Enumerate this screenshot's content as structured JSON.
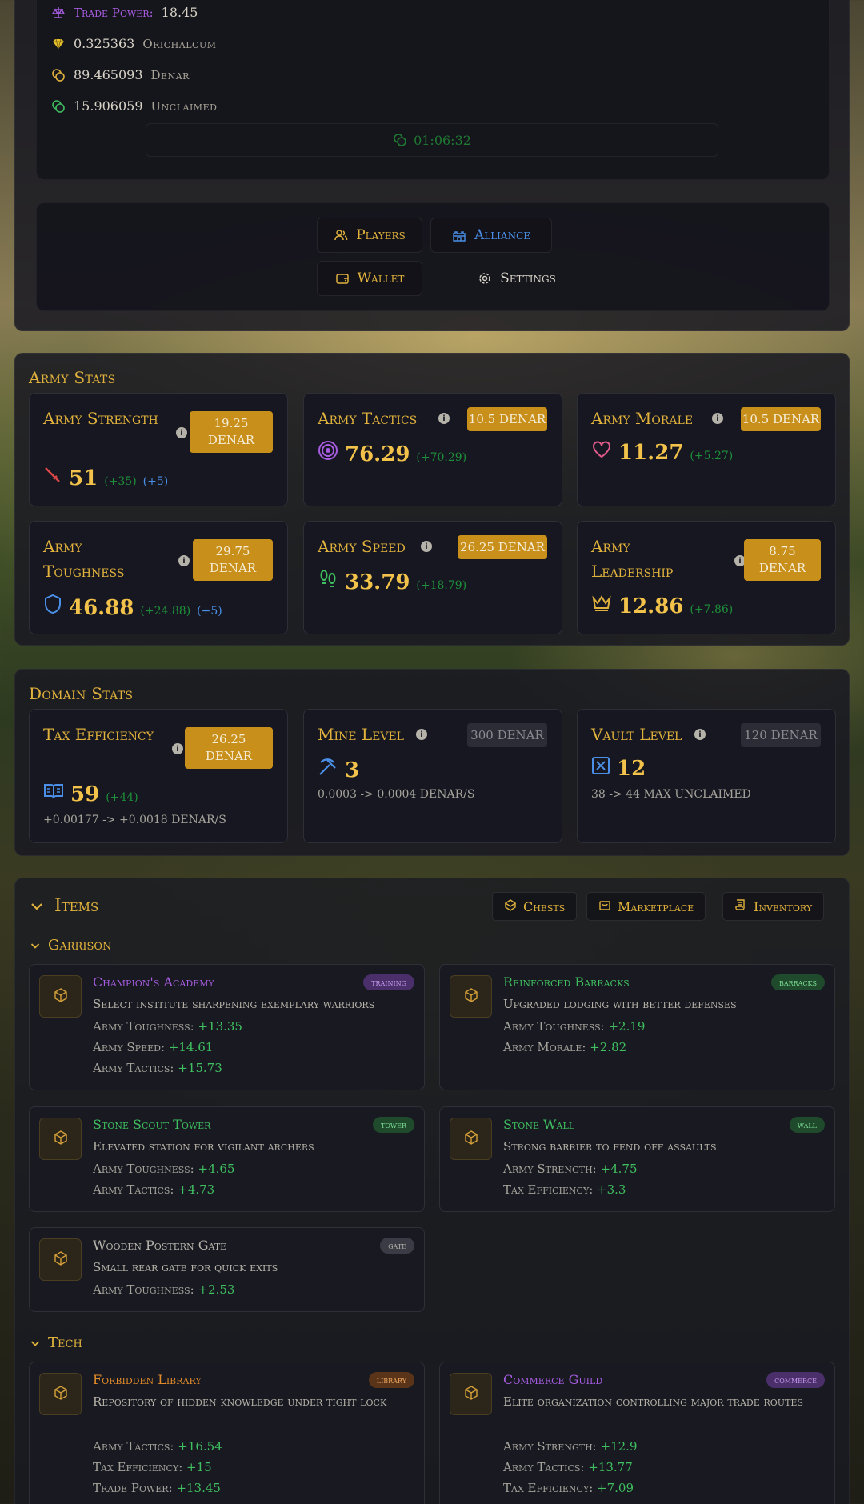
{
  "wallet": {
    "trade_power_label": "Trade Power:",
    "trade_power_value": "18.45",
    "orichalcum_value": "0.325363",
    "orichalcum_label": "Orichalcum",
    "denar_value": "89.465093",
    "denar_label": "Denar",
    "unclaimed_value": "15.906059",
    "unclaimed_label": "Unclaimed",
    "timer": "01:06:32"
  },
  "nav": {
    "players": "Players",
    "alliance": "Alliance",
    "wallet": "Wallet",
    "settings": "Settings"
  },
  "army": {
    "title": "Army Stats",
    "cards": [
      {
        "name": "Army Strength",
        "price": "19.25 DENAR",
        "value": "51",
        "inc": "(+35)",
        "bonus": "(+5)",
        "icon": "sword-icon"
      },
      {
        "name": "Army Tactics",
        "price": "10.5 DENAR",
        "value": "76.29",
        "inc": "(+70.29)",
        "icon": "target-icon"
      },
      {
        "name": "Army Morale",
        "price": "10.5 DENAR",
        "value": "11.27",
        "inc": "(+5.27)",
        "icon": "heart-icon"
      },
      {
        "name": "Army Toughness",
        "price": "29.75 DENAR",
        "value": "46.88",
        "inc": "(+24.88)",
        "bonus": "(+5)",
        "icon": "shield-icon"
      },
      {
        "name": "Army Speed",
        "price": "26.25 DENAR",
        "value": "33.79",
        "inc": "(+18.79)",
        "icon": "footprints-icon"
      },
      {
        "name": "Army Leadership",
        "price": "8.75 DENAR",
        "value": "12.86",
        "inc": "(+7.86)",
        "icon": "crown-icon"
      }
    ]
  },
  "domain": {
    "title": "Domain Stats",
    "cards": [
      {
        "name": "Tax Efficiency",
        "price": "26.25 DENAR",
        "value": "59",
        "inc": "(+44)",
        "sub": "+0.00177 -> +0.0018 DENAR/S",
        "icon": "book-icon"
      },
      {
        "name": "Mine Level",
        "price": "300 DENAR",
        "value": "3",
        "sub": "0.0003 -> 0.0004 DENAR/S",
        "icon": "pickaxe-icon"
      },
      {
        "name": "Vault Level",
        "price": "120 DENAR",
        "value": "12",
        "sub": "38 -> 44 MAX UNCLAIMED",
        "icon": "vault-icon"
      }
    ]
  },
  "items": {
    "title": "Items",
    "chests": "Chests",
    "marketplace": "Marketplace",
    "inventory": "Inventory",
    "garrison_title": "Garrison",
    "tech_title": "Tech",
    "garrison": [
      {
        "name": "Champion's Academy",
        "tag": "training",
        "color": "#a65ce0",
        "desc": "Select institute sharpening exemplary warriors",
        "stats": [
          [
            "Army Toughness:",
            "+13.35"
          ],
          [
            "Army Speed:",
            "+14.61"
          ],
          [
            "Army Tactics:",
            "+15.73"
          ]
        ]
      },
      {
        "name": "Reinforced Barracks",
        "tag": "barracks",
        "color": "#3fbf5f",
        "desc": "Upgraded lodging with better defenses",
        "stats": [
          [
            "Army Toughness:",
            "+2.19"
          ],
          [
            "Army Morale:",
            "+2.82"
          ]
        ]
      },
      {
        "name": "Stone Scout Tower",
        "tag": "tower",
        "color": "#3fbf5f",
        "desc": "Elevated station for vigilant archers",
        "stats": [
          [
            "Army Toughness:",
            "+4.65"
          ],
          [
            "Army Tactics:",
            "+4.73"
          ]
        ]
      },
      {
        "name": "Stone Wall",
        "tag": "wall",
        "color": "#3fbf5f",
        "desc": "Strong barrier to fend off assaults",
        "stats": [
          [
            "Army Strength:",
            "+4.75"
          ],
          [
            "Tax Efficiency:",
            "+3.3"
          ]
        ]
      },
      {
        "name": "Wooden Postern Gate",
        "tag": "gate",
        "color": "#b8b5ac",
        "desc": "Small rear gate for quick exits",
        "stats": [
          [
            "Army Toughness:",
            "+2.53"
          ]
        ]
      }
    ],
    "tech": [
      {
        "name": "Forbidden Library",
        "tag": "library",
        "color": "#e08a2a",
        "desc": "Repository of hidden knowledge under tight lock",
        "stats": [
          [
            "Army Tactics:",
            "+16.54"
          ],
          [
            "Tax Efficiency:",
            "+15"
          ],
          [
            "Trade Power:",
            "+13.45"
          ]
        ]
      },
      {
        "name": "Commerce Guild",
        "tag": "commerce",
        "color": "#a65ce0",
        "desc": "Elite organization controlling major trade routes",
        "stats": [
          [
            "Army Strength:",
            "+12.9"
          ],
          [
            "Army Tactics:",
            "+13.77"
          ],
          [
            "Tax Efficiency:",
            "+7.09"
          ]
        ]
      }
    ]
  }
}
